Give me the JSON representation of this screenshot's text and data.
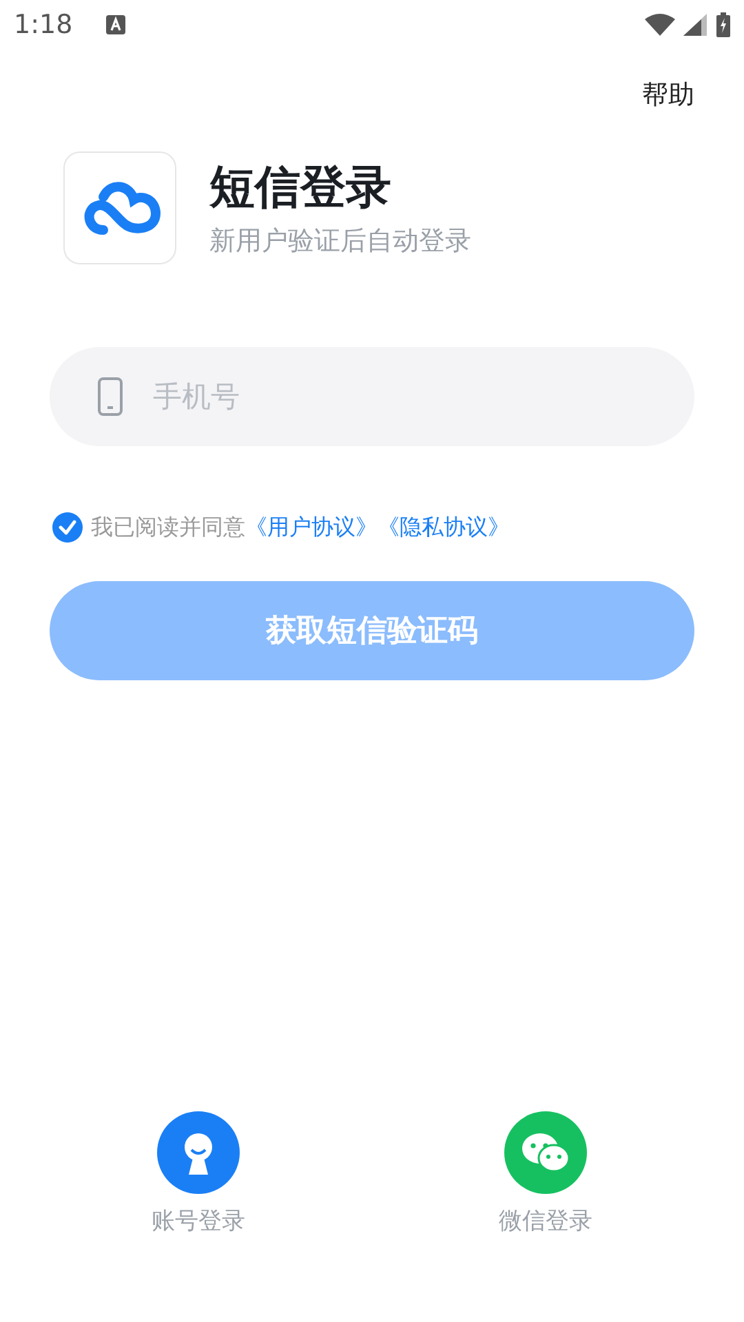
{
  "status_bar": {
    "time": "1:18"
  },
  "help": "帮助",
  "header": {
    "title": "短信登录",
    "subtitle": "新用户验证后自动登录"
  },
  "phone_field": {
    "placeholder": "手机号"
  },
  "agreement": {
    "checked": true,
    "text": "我已阅读并同意",
    "links": [
      "《用户协议》",
      "《隐私协议》"
    ]
  },
  "submit": {
    "label": "获取短信验证码",
    "disabled": true
  },
  "login_options": [
    {
      "kind": "account",
      "label": "账号登录",
      "color": "#1a7ff5"
    },
    {
      "kind": "wechat",
      "label": "微信登录",
      "color": "#16c060"
    }
  ]
}
